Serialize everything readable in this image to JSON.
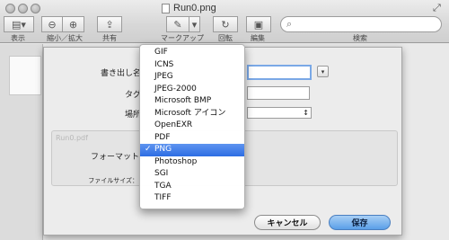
{
  "window": {
    "title": "Run0.png"
  },
  "toolbar": {
    "view_label": "表示",
    "zoom_label": "縮小／拡大",
    "share_label": "共有",
    "markup_label": "マークアップ",
    "rotate_label": "回転",
    "edit_label": "編集",
    "search_label": "検索"
  },
  "sheet": {
    "export_as_label": "書き出し名",
    "tags_label": "タグ",
    "where_label": "場所",
    "format_label": "フォーマット：",
    "filesize_label": "ファイルサイズ：",
    "cancel_label": "キャンセル",
    "save_label": "保存",
    "ghost_pdf": "Run0.pdf"
  },
  "format_menu": {
    "items": [
      "GIF",
      "ICNS",
      "JPEG",
      "JPEG-2000",
      "Microsoft BMP",
      "Microsoft アイコン",
      "OpenEXR",
      "PDF",
      "PNG",
      "Photoshop",
      "SGI",
      "TGA",
      "TIFF"
    ],
    "selected": "PNG",
    "check_glyph": "✓"
  },
  "icons": {
    "view": "sidebar-view-icon",
    "zoom_out": "zoom-out-icon",
    "zoom_in": "zoom-in-icon",
    "share": "share-icon",
    "markup": "pen-icon",
    "rotate": "rotate-icon",
    "edit": "edit-toolbox-icon",
    "search": "magnifier-icon"
  },
  "colors": {
    "accent": "#2d6de3",
    "save_button": "#5a9fe8",
    "focus_ring": "#7aa8e6"
  }
}
